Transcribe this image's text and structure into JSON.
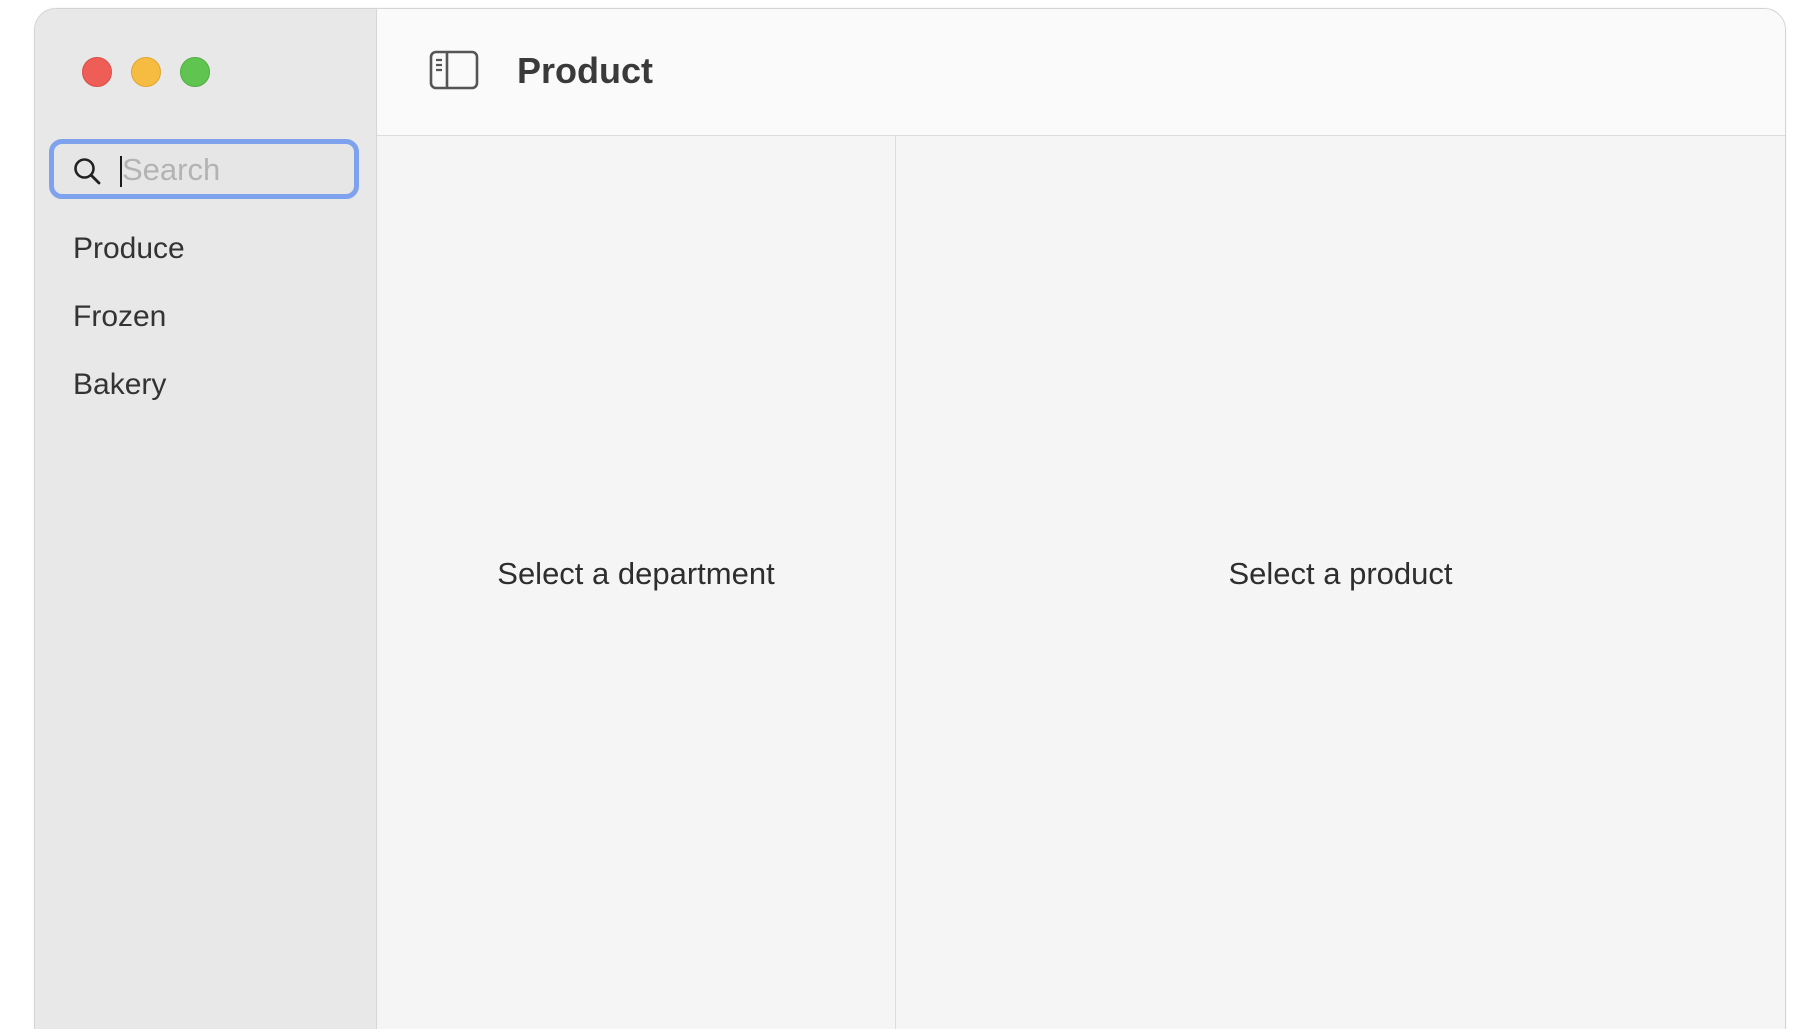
{
  "window": {
    "controls": {
      "close": "close",
      "minimize": "minimize",
      "zoom": "zoom"
    }
  },
  "sidebar": {
    "search": {
      "placeholder": "Search",
      "value": ""
    },
    "items": [
      {
        "label": "Produce"
      },
      {
        "label": "Frozen"
      },
      {
        "label": "Bakery"
      }
    ]
  },
  "toolbar": {
    "toggle_icon": "sidebar-toggle-icon",
    "title": "Product"
  },
  "content": {
    "department_placeholder": "Select a department",
    "product_placeholder": "Select a product"
  },
  "colors": {
    "close": "#ee5e57",
    "minimize": "#f6bc41",
    "zoom": "#5fc550",
    "focus_ring": "#7ea2ee"
  }
}
